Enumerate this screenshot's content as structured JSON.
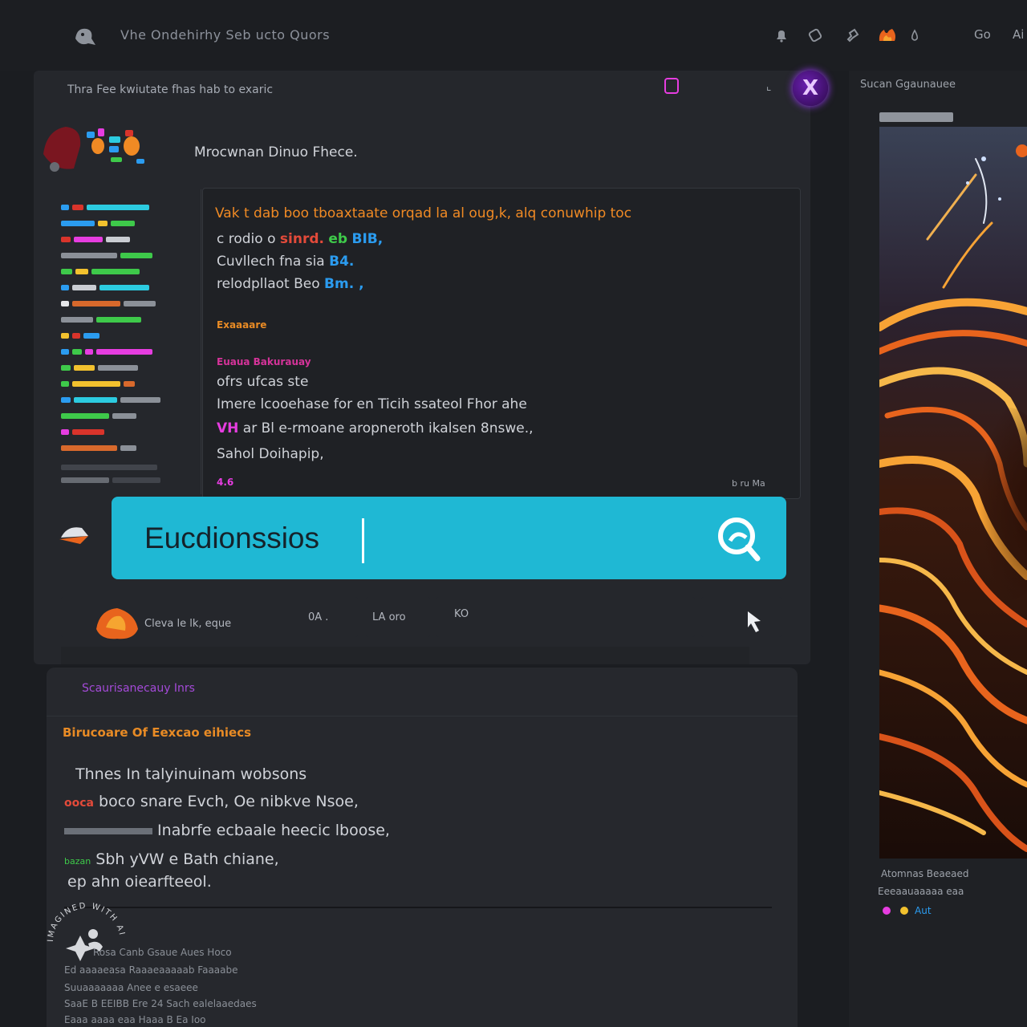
{
  "topbar": {
    "app_title": "Vhe Ondehirhy Seb ucto Quors",
    "right_text_1": "Go",
    "right_text_2": "Ai"
  },
  "main_panel": {
    "header_text": "Thra Fee kwiutate fhas hab to exaric",
    "section_title": "Mrocwnan Dinuo Fhece.",
    "card": {
      "orange_line": "Vak t dab boo tboaxtaate orqad la al oug,k, alq conuwhip toc",
      "line_1_prefix": "c rodio o",
      "line_1_hl_a": "sinrd.",
      "line_1_hl_b": "eb",
      "line_1_hl_c": "BIB,",
      "line_2_prefix": "Cuvllech fna sia",
      "line_2_hl": "B4.",
      "line_3_prefix": "relodpllaot Beo",
      "line_3_hl": "Bm. ,",
      "heading_orange": "Exaaaare",
      "heading_pink": "Euaua Bakurauay",
      "line_4": "ofrs ufcas ste",
      "line_5": "Imere lcooehase for en Ticih ssateol Fhor ahe",
      "line_6_hl": "VH",
      "line_6": "ar Bl e-rmoane aropneroth ikalsen 8nswe.,",
      "line_7": "Sahol Doihapip,",
      "foot_left": "4.6",
      "foot_right": "b ru Ma"
    },
    "search": {
      "value": "Eucdionssios",
      "icon": "search-icon"
    },
    "strip": {
      "cell_1_label": "Cleva le lk, eque",
      "cell_2_label": "0A .",
      "cell_3_label": "LA oro",
      "cell_4_label": "KO",
      "action_icon": "pointer-icon"
    }
  },
  "lower_panel": {
    "tab_label": "Scaurisanecauy Inrs",
    "heading": "Birucoare Of Eexcao eihiecs",
    "lines": [
      "Thnes In talyinuinam wobsons",
      "boco snare Evch, Oe nibkve Nsoe,",
      "Inabrfe ecbaale heecic lboose,",
      "Sbh yVW e Bath chiane,",
      "ep ahn oiearfteeol."
    ],
    "chip_1": "ooca",
    "chip_2": "Inabrfe",
    "chip_3": "bazan",
    "footer_rows": [
      "Rosa Canb Gsaue Aues Hoco",
      "Ed aaaaeasa Raaaeaaaaab Faaaabe",
      "Suuaaaaaaa Anee e esaeee",
      "SaaE B EEIBB Ere 24 Sach ealelaaedaes",
      "Eaaa aaaa eaa Haaa B Ea Ioo"
    ]
  },
  "right_panel": {
    "title": "Sucan Ggaunauee",
    "meta_1": "Atomnas Beaeaed",
    "meta_2": "Eeeaauaaaaa eaa",
    "meta_3": "Aut"
  },
  "colors": {
    "accent_cyan": "#1fb8d4",
    "accent_orange": "#f08a24",
    "accent_pink": "#e63de0",
    "accent_purple": "#a44ad8",
    "background": "#1b1d21"
  },
  "watermark": {
    "text": "IMAGINED WITH AI"
  }
}
